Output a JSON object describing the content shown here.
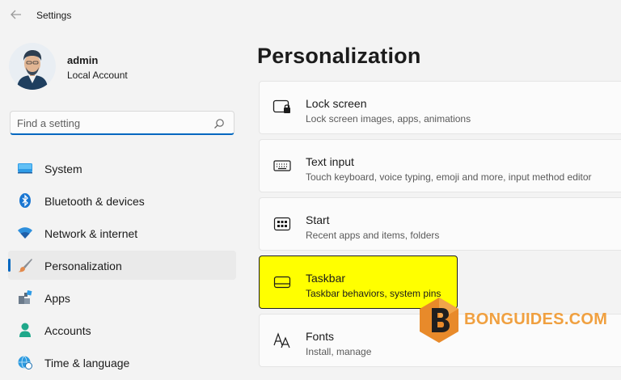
{
  "window": {
    "title": "Settings"
  },
  "profile": {
    "name": "admin",
    "account_type": "Local Account"
  },
  "search": {
    "placeholder": "Find a setting"
  },
  "sidebar": {
    "items": [
      {
        "label": "System",
        "icon": "monitor-icon"
      },
      {
        "label": "Bluetooth & devices",
        "icon": "bluetooth-icon"
      },
      {
        "label": "Network & internet",
        "icon": "wifi-icon"
      },
      {
        "label": "Personalization",
        "icon": "brush-icon",
        "selected": true
      },
      {
        "label": "Apps",
        "icon": "apps-icon"
      },
      {
        "label": "Accounts",
        "icon": "person-icon"
      },
      {
        "label": "Time & language",
        "icon": "globe-clock-icon"
      }
    ]
  },
  "main": {
    "title": "Personalization",
    "cards": [
      {
        "title": "Lock screen",
        "subtitle": "Lock screen images, apps, animations",
        "icon": "lock-screen-icon"
      },
      {
        "title": "Text input",
        "subtitle": "Touch keyboard, voice typing, emoji and more, input method editor",
        "icon": "keyboard-icon"
      },
      {
        "title": "Start",
        "subtitle": "Recent apps and items, folders",
        "icon": "start-icon"
      },
      {
        "title": "Taskbar",
        "subtitle": "Taskbar behaviors, system pins",
        "icon": "taskbar-icon",
        "highlighted": true
      },
      {
        "title": "Fonts",
        "subtitle": "Install, manage",
        "icon": "fonts-icon"
      }
    ]
  },
  "watermark": {
    "text": "BONGUIDES.COM"
  },
  "colors": {
    "accent": "#0067c0",
    "highlight": "#ffff00",
    "watermark": "#f0a040",
    "background": "#f3f3f3"
  }
}
